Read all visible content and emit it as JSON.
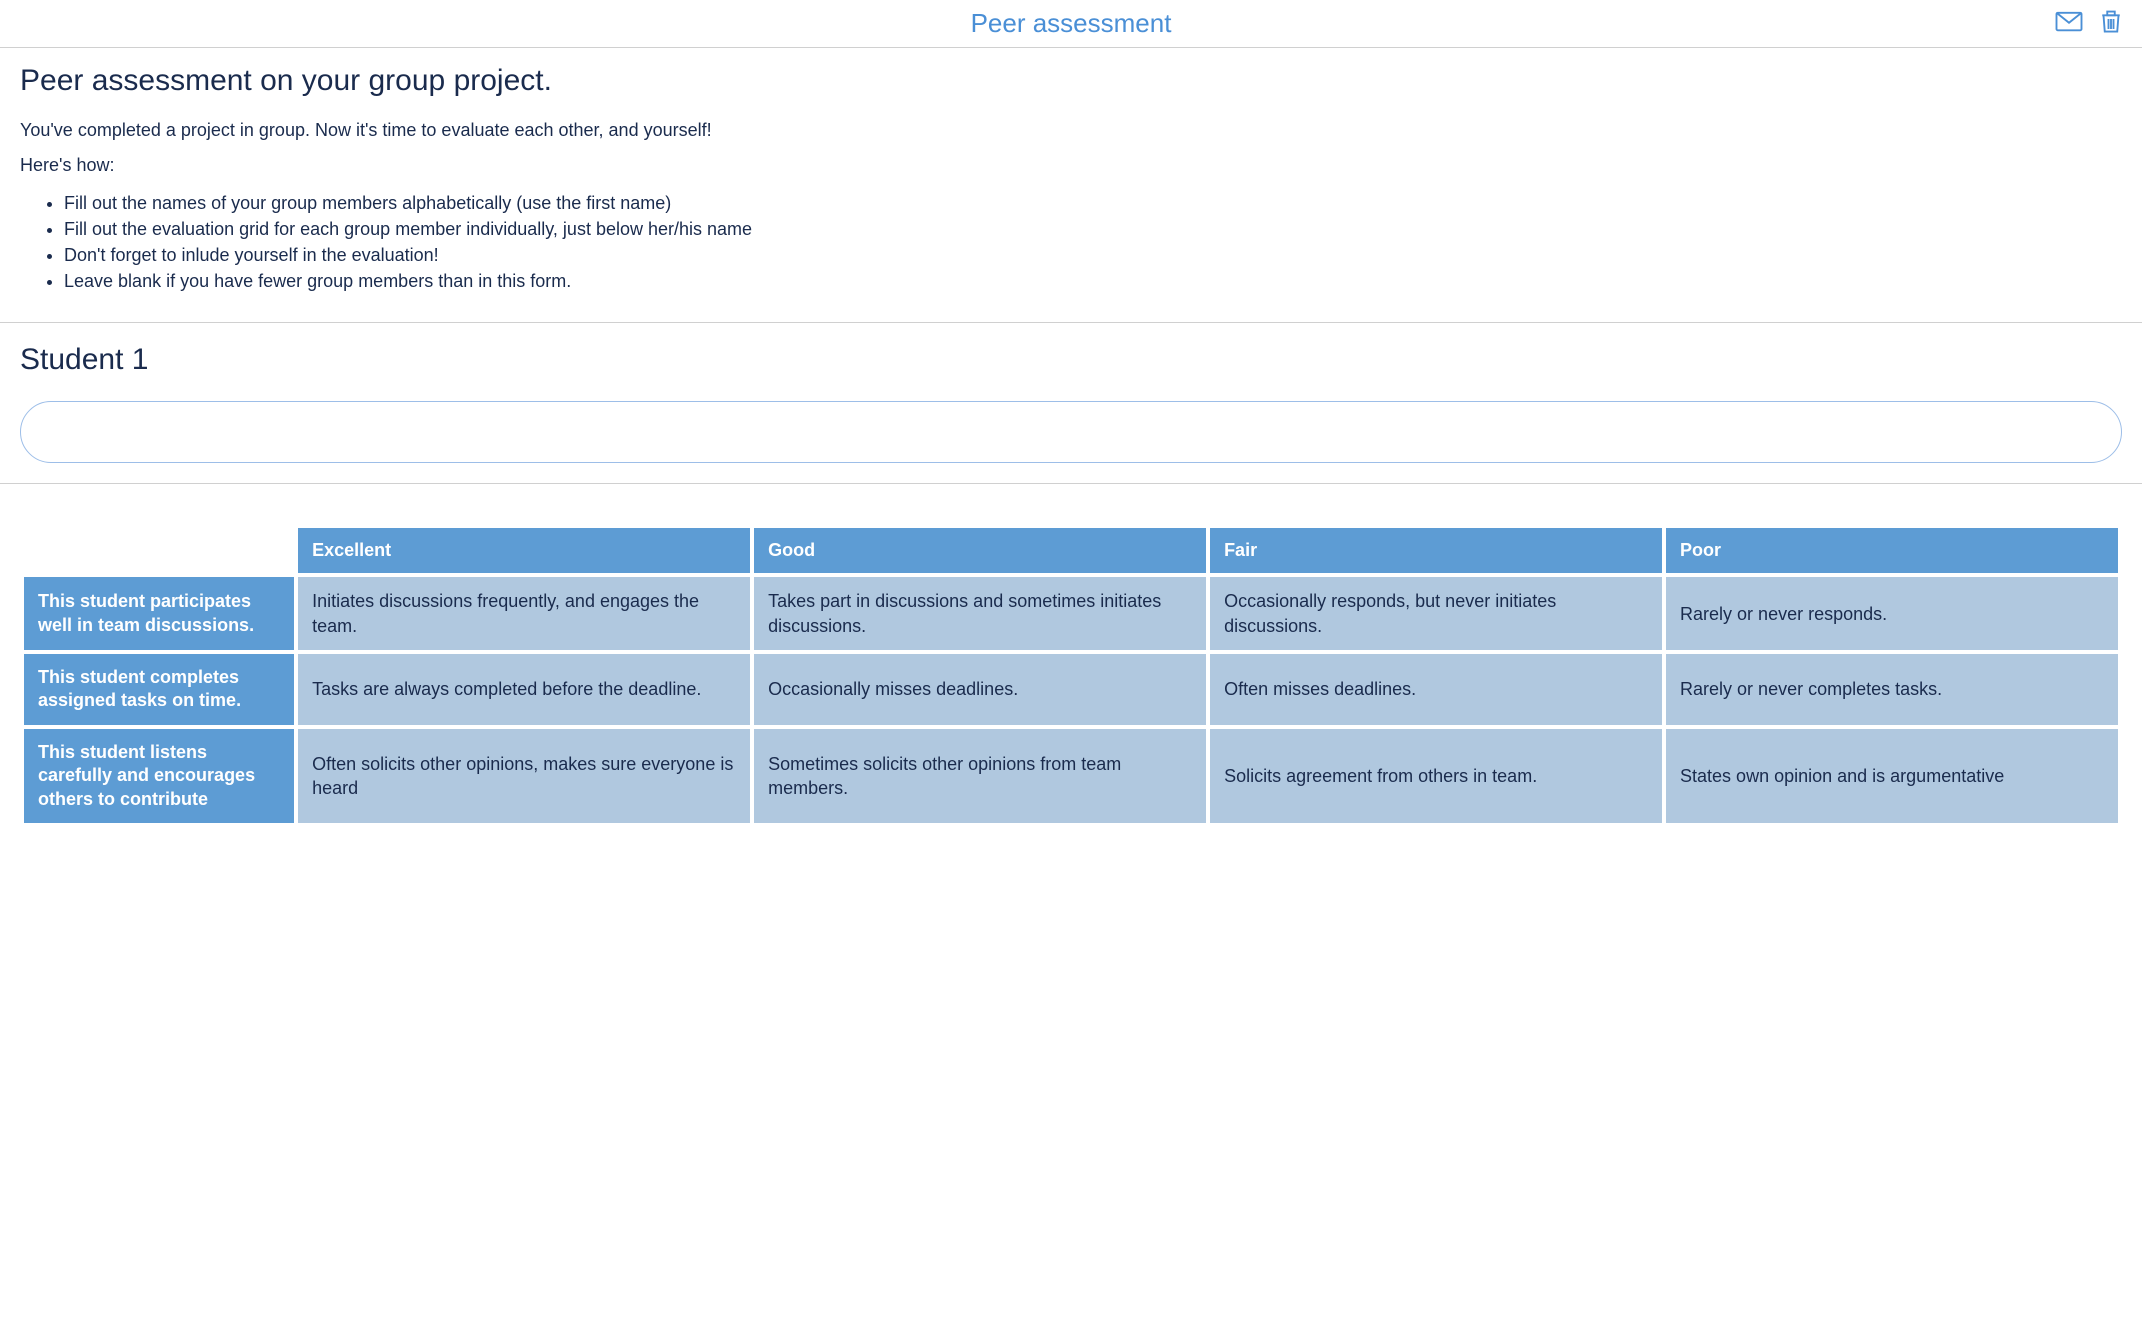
{
  "header": {
    "title": "Peer assessment"
  },
  "intro": {
    "heading": "Peer assessment on your group project.",
    "line1": "You've completed a project in group. Now it's time to evaluate each other, and yourself!",
    "line2": "Here's how:",
    "bullets": [
      "Fill out the names of your group members alphabetically (use the first name)",
      "Fill out the evaluation grid for each group member individually, just below her/his name",
      "Don't forget to inlude yourself in the evaluation!",
      "Leave blank if you have fewer group members than in this form."
    ]
  },
  "student": {
    "heading": "Student 1",
    "input_placeholder": ""
  },
  "rubric": {
    "columns": [
      "Excellent",
      "Good",
      "Fair",
      "Poor"
    ],
    "rows": [
      {
        "label": "This student participates well in team discussions.",
        "cells": [
          "Initiates discussions frequently, and engages the team.",
          "Takes part in discussions and sometimes initiates discussions.",
          "Occasionally responds, but never initiates discussions.",
          "Rarely or never responds."
        ]
      },
      {
        "label": "This student completes assigned tasks on time.",
        "cells": [
          "Tasks are always completed before the deadline.",
          "Occasionally misses deadlines.",
          "Often misses deadlines.",
          "Rarely or never completes tasks."
        ]
      },
      {
        "label": "This student listens carefully and encourages others to contribute",
        "cells": [
          "Often solicits other opinions, makes sure everyone is heard",
          "Sometimes solicits other opinions from team members.",
          "Solicits agreement from others in team.",
          "States own opinion and is argumentative"
        ]
      }
    ]
  }
}
